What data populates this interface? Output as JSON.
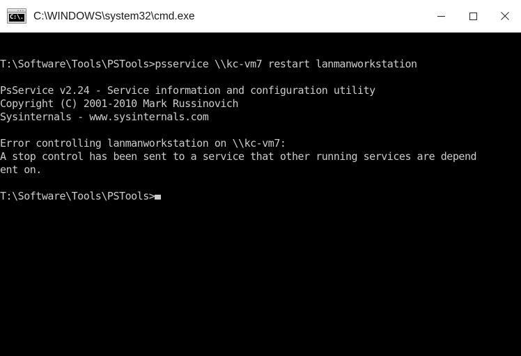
{
  "window": {
    "title": "C:\\WINDOWS\\system32\\cmd.exe",
    "icon_name": "cmd-console-icon",
    "icon_glyph": "C:\\.",
    "background": "#000000",
    "titlebar_background": "#ffffff",
    "text_color": "#cccccc"
  },
  "controls": {
    "minimize_label": "Minimize",
    "maximize_label": "Maximize",
    "close_label": "Close"
  },
  "console": {
    "lines": [
      {
        "text": "T:\\Software\\Tools\\PSTools>psservice \\\\kc-vm7 restart lanmanworkstation",
        "blank": false
      },
      {
        "text": "",
        "blank": true
      },
      {
        "text": "PsService v2.24 - Service information and configuration utility",
        "blank": false
      },
      {
        "text": "Copyright (C) 2001-2010 Mark Russinovich",
        "blank": false
      },
      {
        "text": "Sysinternals - www.sysinternals.com",
        "blank": false
      },
      {
        "text": "",
        "blank": true
      },
      {
        "text": "Error controlling lanmanworkstation on \\\\kc-vm7:",
        "blank": false
      },
      {
        "text": "A stop control has been sent to a service that other running services are depend",
        "blank": false
      },
      {
        "text": "ent on.",
        "blank": false
      },
      {
        "text": "",
        "blank": true
      },
      {
        "text": "T:\\Software\\Tools\\PSTools>",
        "blank": false
      }
    ],
    "prompt": "T:\\Software\\Tools\\PSTools>",
    "command": "psservice \\\\kc-vm7 restart lanmanworkstation",
    "program_name": "PsService",
    "program_version": "v2.24",
    "program_description": "Service information and configuration utility",
    "copyright": "Copyright (C) 2001-2010 Mark Russinovich",
    "vendor": "Sysinternals - www.sysinternals.com",
    "error_header": "Error controlling lanmanworkstation on \\\\kc-vm7:",
    "error_body": "A stop control has been sent to a service that other running services are dependent on.",
    "target_host": "\\\\kc-vm7",
    "service_name": "lanmanworkstation",
    "cursor_visible": true
  }
}
